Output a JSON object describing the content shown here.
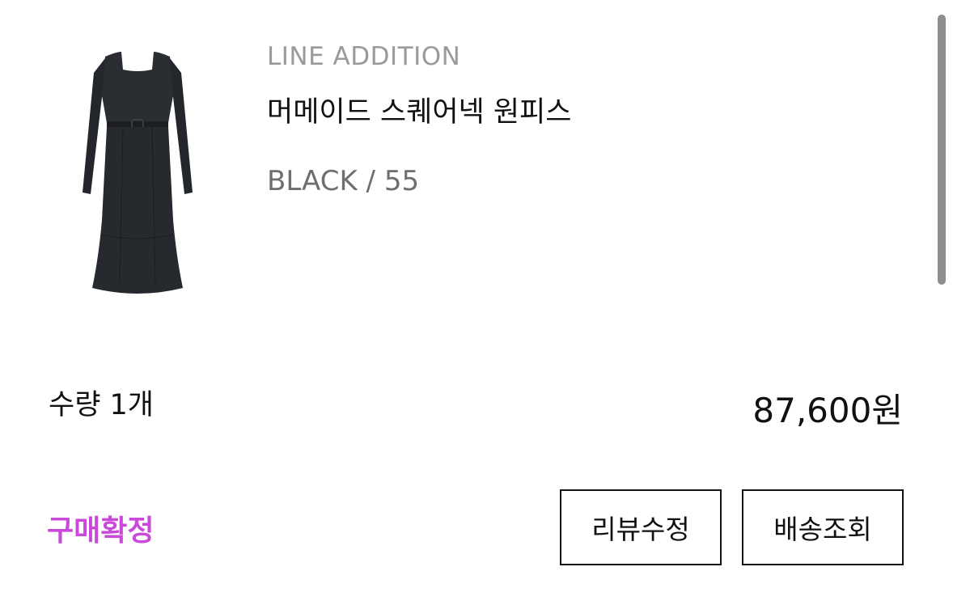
{
  "product": {
    "image_icon": "dress-image",
    "brand": "LINE ADDITION",
    "name": "머메이드 스퀘어넥 원피스",
    "option": "BLACK / 55"
  },
  "order": {
    "quantity_label": "수량 1개",
    "price": "87,600원",
    "status": "구매확정"
  },
  "actions": {
    "review_edit_label": "리뷰수정",
    "delivery_track_label": "배송조회"
  },
  "colors": {
    "status": "#c94ad8",
    "text": "#111111",
    "muted": "#9a9a9a"
  }
}
